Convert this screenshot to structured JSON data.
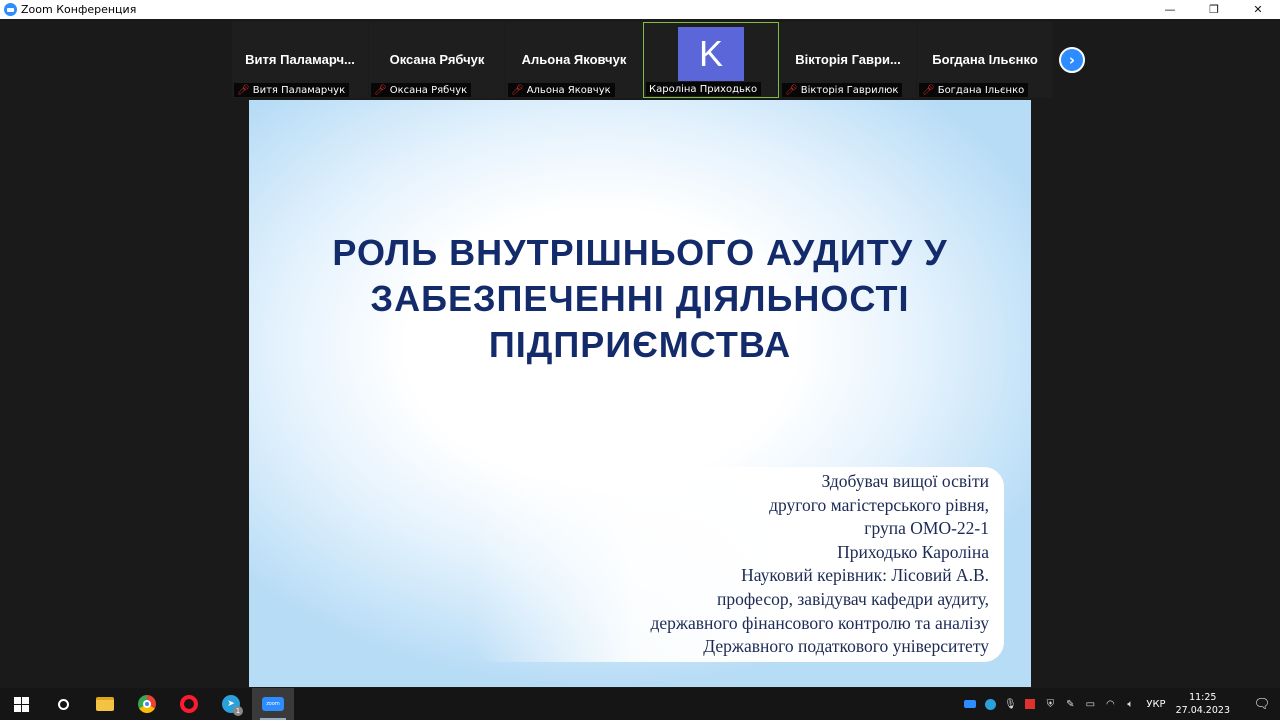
{
  "window": {
    "title": "Zoom Конференция",
    "minimize": "—",
    "maximize": "❐",
    "close": "✕"
  },
  "participants": [
    {
      "display": "Витя  Паламарч...",
      "label": "Витя Паламарчук",
      "muted": true
    },
    {
      "display": "Оксана Рябчук",
      "label": "Оксана Рябчук",
      "muted": true
    },
    {
      "display": "Альона Яковчук",
      "label": "Альона Яковчук",
      "muted": true
    },
    {
      "display": "",
      "label": "Кароліна Приходько",
      "muted": false,
      "avatar": "K",
      "active": true
    },
    {
      "display": "Вікторія  Гаври...",
      "label": "Вікторія Гаврилюк",
      "muted": true
    },
    {
      "display": "Богдана Ільєнко",
      "label": "Богдана Ільєнко",
      "muted": true
    }
  ],
  "next_button": "›",
  "slide": {
    "title_lines": [
      "РОЛЬ ВНУТРІШНЬОГО АУДИТУ У",
      "ЗАБЕЗПЕЧЕННІ ДІЯЛЬНОСТІ",
      "ПІДПРИЄМСТВА"
    ],
    "info_lines": [
      "Здобувач вищої освіти",
      "другого магістерського рівня,",
      "група ОМО-22-1",
      "Приходько Кароліна",
      "Науковий керівник: Лісовий А.В.",
      "професор, завідувач кафедри аудиту,",
      "державного фінансового контролю та аналізу",
      "Державного податкового університету"
    ]
  },
  "taskbar": {
    "items": [
      "windows-start-icon",
      "search-icon",
      "file-explorer-icon",
      "chrome-icon",
      "opera-icon",
      "telegram-icon",
      "zoom-icon"
    ],
    "telegram_badge": "1",
    "zoom_label": "zoom",
    "language": "УКР",
    "time": "11:25",
    "date": "27.04.2023"
  },
  "colors": {
    "zoom_blue": "#2d8cff",
    "slide_title": "#142b6b",
    "avatar_bg": "#5b67d9",
    "active_border": "#7fbf3f",
    "mute_red": "#e0322d"
  }
}
